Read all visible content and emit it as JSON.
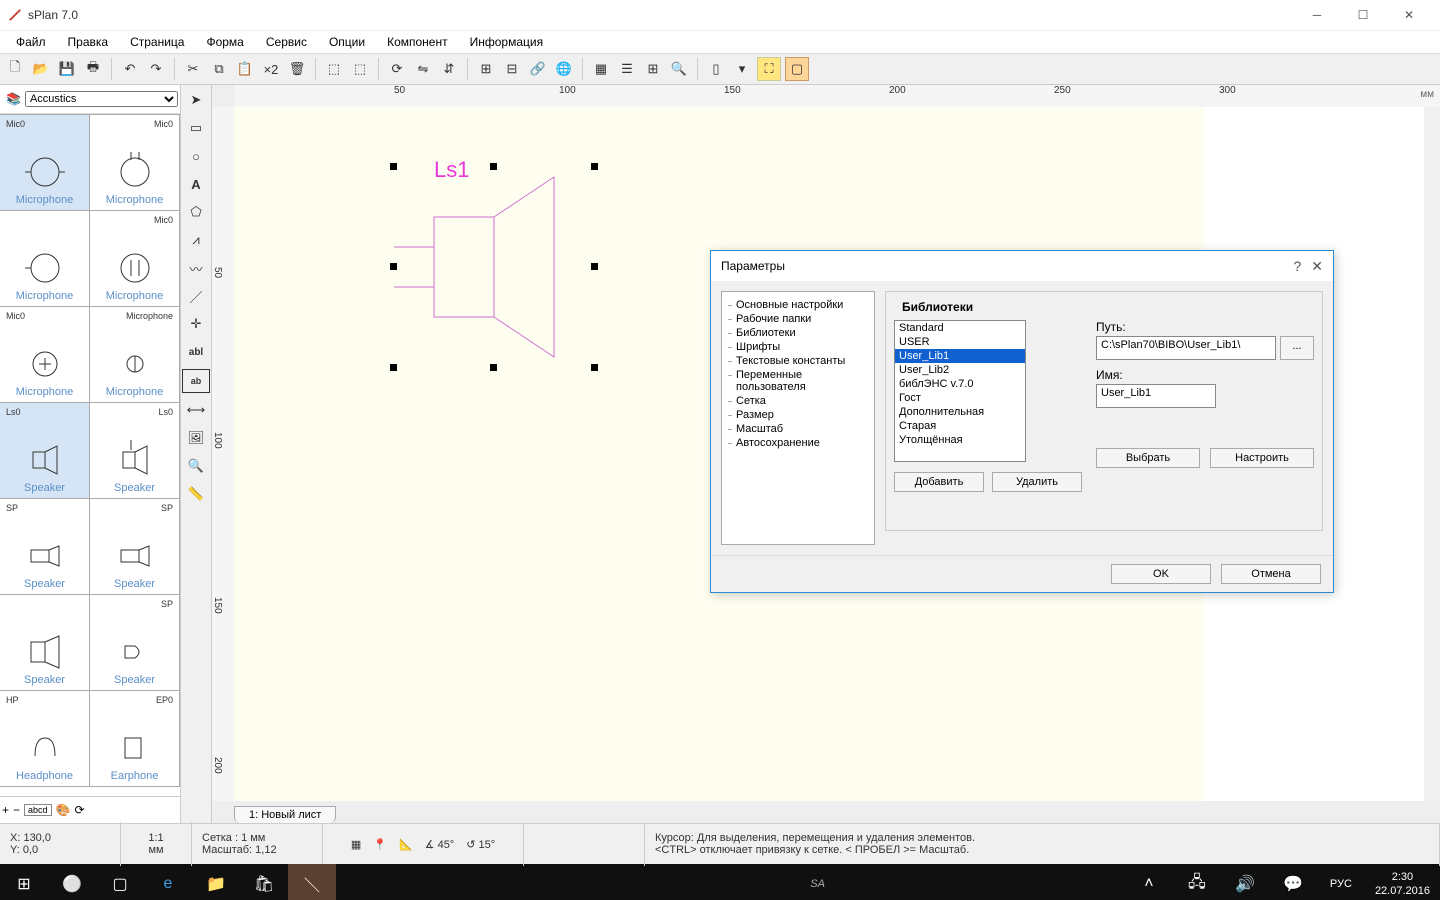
{
  "window": {
    "title": "sPlan 7.0"
  },
  "menu": [
    "Файл",
    "Правка",
    "Страница",
    "Форма",
    "Сервис",
    "Опции",
    "Компонент",
    "Информация"
  ],
  "library": {
    "selected": "Accustics",
    "items": [
      {
        "label": "Microphone",
        "tag": "Mic0",
        "sel": true
      },
      {
        "label": "Microphone",
        "tag": "Mic0"
      },
      {
        "label": "Microphone",
        "tag": ""
      },
      {
        "label": "Microphone",
        "tag": "Mic0"
      },
      {
        "label": "Microphone",
        "tag": "Mic0"
      },
      {
        "label": "Microphone",
        "tag": "Microphone"
      },
      {
        "label": "Speaker",
        "tag": "Ls0",
        "sel": true
      },
      {
        "label": "Speaker",
        "tag": "Ls0"
      },
      {
        "label": "Speaker",
        "tag": "SP"
      },
      {
        "label": "Speaker",
        "tag": "SP"
      },
      {
        "label": "Speaker",
        "tag": ""
      },
      {
        "label": "Speaker",
        "tag": "SP"
      },
      {
        "label": "Headphone",
        "tag": "HP"
      },
      {
        "label": "Earphone",
        "tag": "EP0"
      }
    ]
  },
  "ruler": {
    "ticks": [
      "50",
      "100",
      "150",
      "200",
      "250",
      "300"
    ],
    "unit": "мм",
    "vticks": [
      "50",
      "100",
      "150",
      "200"
    ]
  },
  "canvas": {
    "label": "Ls1",
    "tab": "1: Новый лист"
  },
  "status": {
    "coords": {
      "x": "X: 130,0",
      "y": "Y: 0,0"
    },
    "scale": {
      "a": "1:1",
      "b": "мм"
    },
    "grid": {
      "a": "Сетка : 1 мм",
      "b": "Масштаб:  1,12"
    },
    "angles": {
      "a": "∡ 45°",
      "b": "↺ 15°"
    },
    "hint1": "Курсор: Для выделения, перемещения и удаления элементов.",
    "hint2": "<CTRL> отключает привязку к сетке. < ПРОБЕЛ >= Масштаб."
  },
  "dialog": {
    "title": "Параметры",
    "tree": [
      "Основные настройки",
      "Рабочие папки",
      "Библиотеки",
      "Шрифты",
      "Текстовые константы",
      "Переменные пользователя",
      "Сетка",
      "Размер",
      "Масштаб",
      "Автосохранение"
    ],
    "group": "Библиотеки",
    "libs": [
      "Standard",
      "USER",
      "User_Lib1",
      "User_Lib2",
      "библЭНС v.7.0",
      "Гост",
      "Дополнительная",
      "Старая",
      "Утолщённая"
    ],
    "selectedLib": "User_Lib1",
    "pathLabel": "Путь:",
    "path": "C:\\sPlan70\\BIBO\\User_Lib1\\",
    "nameLabel": "Имя:",
    "name": "User_Lib1",
    "btnBrowse": "...",
    "btnSelect": "Выбрать",
    "btnConfig": "Настроить",
    "btnAdd": "Добавить",
    "btnDel": "Удалить",
    "btnOk": "OK",
    "btnCancel": "Отмена"
  },
  "taskbar": {
    "lang": "РУС",
    "time": "2:30",
    "date": "22.07.2016"
  }
}
